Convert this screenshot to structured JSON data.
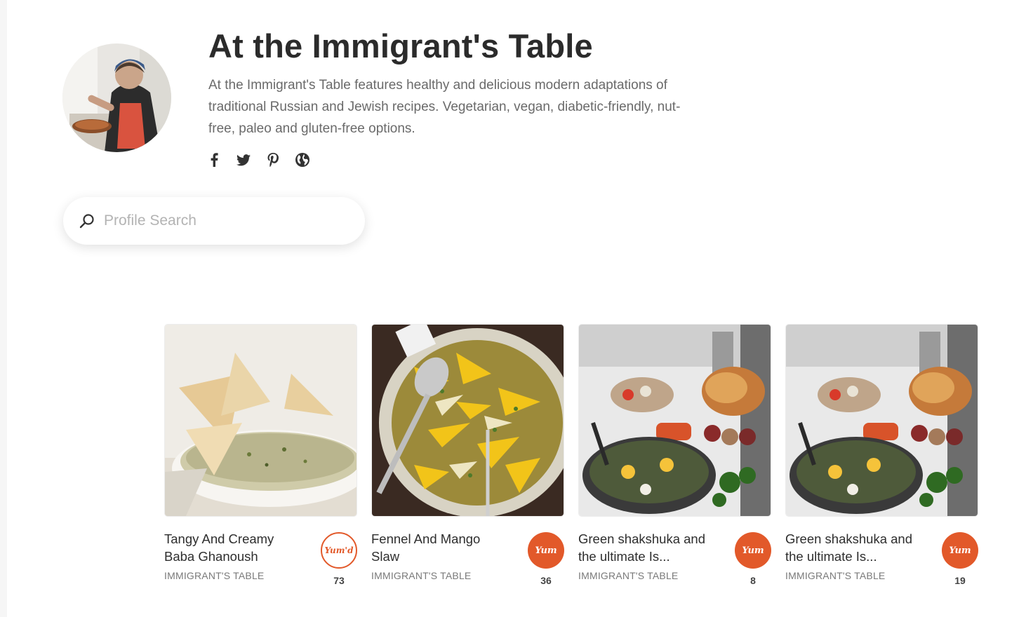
{
  "profile": {
    "title": "At the Immigrant's Table",
    "description": "At the Immigrant's Table features healthy and delicious modern adaptations of traditional Russian and Jewish recipes. Vegetarian, vegan, diabetic-friendly, nut-free, paleo and gluten-free options.",
    "socials": [
      {
        "icon": "facebook-icon"
      },
      {
        "icon": "twitter-icon"
      },
      {
        "icon": "pinterest-icon"
      },
      {
        "icon": "globe-icon"
      }
    ]
  },
  "search": {
    "placeholder": "Profile Search",
    "value": ""
  },
  "recipes": [
    {
      "title": "Tangy And Creamy Baba Ghanoush",
      "source": "IMMIGRANT'S TABLE",
      "yum_label": "Yum'd",
      "yum_state": "yummed",
      "count": "73"
    },
    {
      "title": "Fennel And Mango Slaw",
      "source": "IMMIGRANT'S TABLE",
      "yum_label": "Yum",
      "yum_state": "default",
      "count": "36"
    },
    {
      "title": "Green shakshuka and the ultimate Is...",
      "source": "IMMIGRANT'S TABLE",
      "yum_label": "Yum",
      "yum_state": "default",
      "count": "8"
    },
    {
      "title": "Green shakshuka and the ultimate Is...",
      "source": "IMMIGRANT'S TABLE",
      "yum_label": "Yum",
      "yum_state": "default",
      "count": "19"
    }
  ],
  "colors": {
    "accent": "#e2592a",
    "title": "#2b2b2b",
    "muted": "#6a6a6a"
  }
}
